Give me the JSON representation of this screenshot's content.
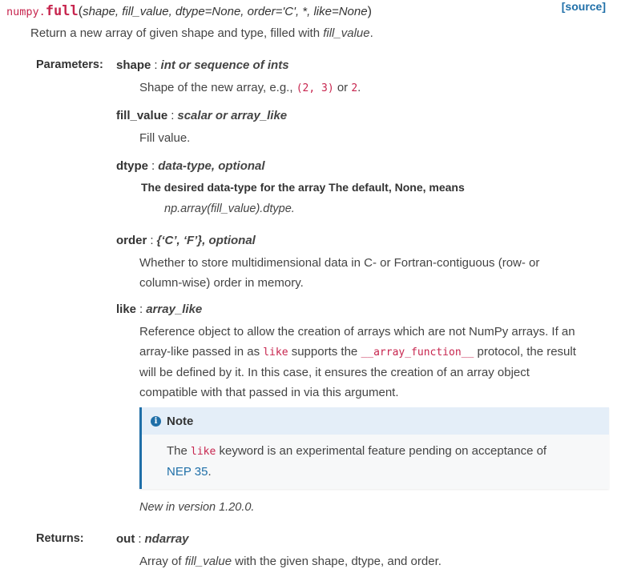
{
  "signature": {
    "module": "numpy.",
    "name": "full",
    "open": "(",
    "params": "shape, fill_value, dtype=None, order='C', *, like=None",
    "close": ")",
    "source_link": "[source]"
  },
  "summary": {
    "prefix": "Return a new array of given shape and type, filled with ",
    "em": "fill_value",
    "suffix": "."
  },
  "labels": {
    "parameters": "Parameters:",
    "returns": "Returns:"
  },
  "params": [
    {
      "name": "shape",
      "sep": ":",
      "type": "int or sequence of ints"
    },
    {
      "name": "fill_value",
      "sep": ":",
      "type": "scalar or array_like"
    },
    {
      "name": "dtype",
      "sep": ":",
      "type": "data-type, optional"
    },
    {
      "name": "order",
      "sep": ":",
      "type": "{‘C’, ‘F’}, optional"
    },
    {
      "name": "like",
      "sep": ":",
      "type": "array_like"
    }
  ],
  "shape_desc": {
    "pre": "Shape of the new array, e.g., ",
    "code1": "(2, 3)",
    "mid": " or ",
    "code2": "2",
    "post": "."
  },
  "fill_desc": "Fill value.",
  "dtype_desc": {
    "bold": "The desired data-type for the array The default, None, means",
    "italic": "np.array(fill_value).dtype",
    "tail": "."
  },
  "order_desc": {
    "line1": "Whether to store multidimensional data in C- or Fortran-contiguous (row- or",
    "line2": "column-wise) order in memory."
  },
  "like_desc": {
    "line1": "Reference object to allow the creation of arrays which are not NumPy arrays. If an",
    "line2_pre": "array-like passed in as ",
    "line2_code1": "like",
    "line2_mid": " supports the ",
    "line2_code2": "__array_function__",
    "line2_post": " protocol, the result",
    "line3": "will be defined by it. In this case, it ensures the creation of an array object",
    "line4": "compatible with that passed in via this argument."
  },
  "note": {
    "icon": "info-icon",
    "title": "Note",
    "pre": "The ",
    "code": "like",
    "post": " keyword is an experimental feature pending on acceptance of",
    "link": "NEP 35",
    "end": "."
  },
  "new_in": "New in version 1.20.0.",
  "returns": {
    "name": "out",
    "sep": ":",
    "type": "ndarray",
    "desc_pre": "Array of ",
    "desc_em": "fill_value",
    "desc_post": " with the given shape, dtype, and order."
  },
  "colors": {
    "code": "#c7254e",
    "link": "#1f6fa8",
    "note_header": "#e4eef8"
  }
}
